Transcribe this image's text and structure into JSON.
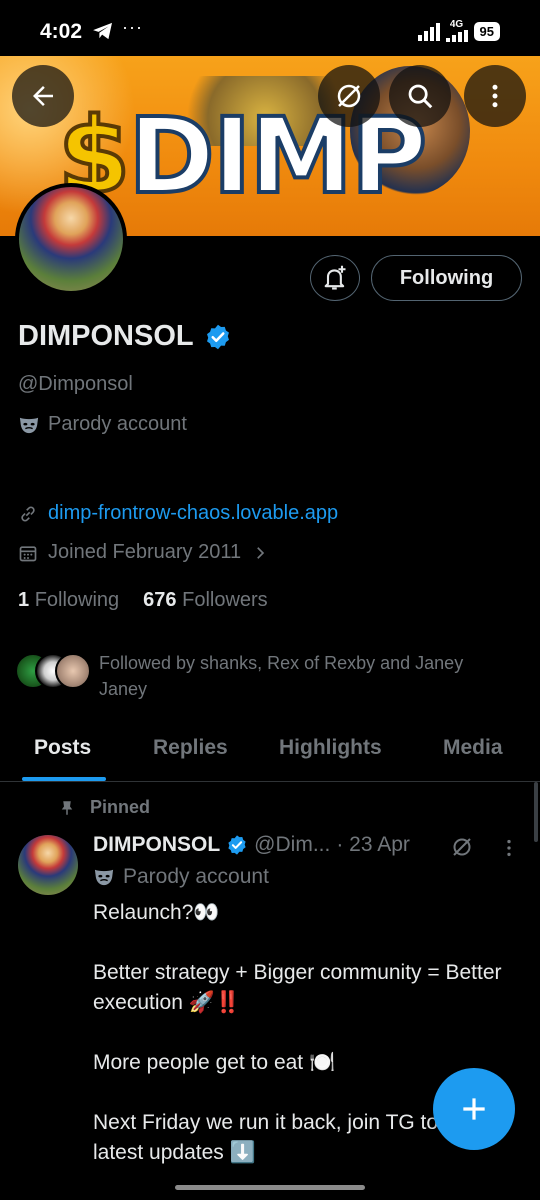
{
  "status_bar": {
    "time": "4:02",
    "dots": "···",
    "network": "4G",
    "battery": "95"
  },
  "banner": {
    "dollar": "$",
    "word": "DIMP"
  },
  "profile": {
    "name": "DIMPONSOL",
    "handle": "@Dimponsol",
    "parody_label": "Parody account",
    "link": "dimp-frontrow-chaos.lovable.app",
    "joined": "Joined February 2011",
    "following_count": "1",
    "following_label": "Following",
    "followers_count": "676",
    "followers_label": "Followers",
    "followed_by": "Followed by shanks, Rex of Rexby and Janey Janey",
    "follow_button": "Following"
  },
  "tabs": [
    {
      "label": "Posts"
    },
    {
      "label": "Replies"
    },
    {
      "label": "Highlights"
    },
    {
      "label": "Media"
    }
  ],
  "pinned_post": {
    "pinned_label": "Pinned",
    "name": "DIMPONSOL",
    "handle": "@Dim...",
    "date": "· 23 Apr",
    "parody_label": "Parody account",
    "body": "Relaunch?👀\n\nBetter strategy + Bigger community = Better execution 🚀‼️\n\nMore people get to eat 🍽️\n\nNext Friday we run it back, join TG to get the latest updates ⬇️"
  },
  "colors": {
    "accent": "#1d9bf0",
    "banner_orange": "#f08a0e",
    "muted": "#71767b"
  }
}
